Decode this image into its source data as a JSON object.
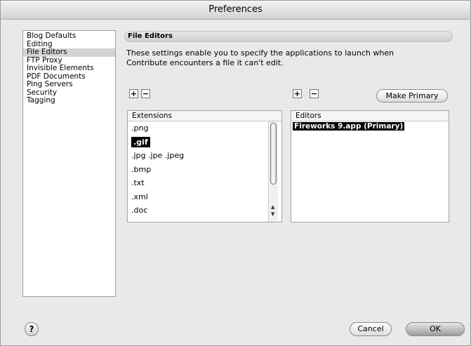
{
  "window": {
    "title": "Preferences"
  },
  "sidebar": {
    "items": [
      {
        "label": "Blog Defaults"
      },
      {
        "label": "Editing"
      },
      {
        "label": "File Editors",
        "selected": true
      },
      {
        "label": "FTP Proxy"
      },
      {
        "label": "Invisible Elements"
      },
      {
        "label": "PDF Documents"
      },
      {
        "label": "Ping Servers"
      },
      {
        "label": "Security"
      },
      {
        "label": "Tagging"
      }
    ]
  },
  "section": {
    "title": "File Editors",
    "description": "These settings enable you to specify the applications to launch when Contribute encounters a file it can't edit."
  },
  "extensions": {
    "add_label": "+",
    "remove_label": "−",
    "header": "Extensions",
    "items": [
      ".png",
      ".gif",
      ".jpg .jpe .jpeg",
      ".bmp",
      ".txt",
      ".xml",
      ".doc"
    ],
    "selected_index": 1
  },
  "editors": {
    "add_label": "+",
    "remove_label": "−",
    "make_primary_label": "Make Primary",
    "header": "Editors",
    "items": [
      "Fireworks 9.app (Primary)"
    ],
    "selected_index": 0
  },
  "footer": {
    "help_label": "?",
    "cancel_label": "Cancel",
    "ok_label": "OK"
  },
  "icons": {
    "help": "help-icon",
    "scroll_up": "scroll-up-icon",
    "scroll_down": "scroll-down-icon"
  }
}
